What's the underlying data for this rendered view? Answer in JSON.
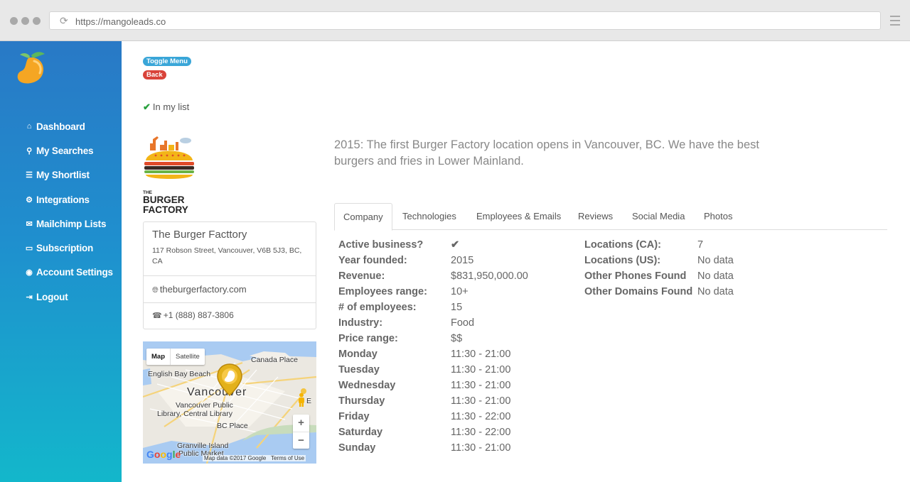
{
  "browser": {
    "url": "https://mangoleads.co"
  },
  "sidebar": {
    "items": [
      {
        "label": "Dashboard",
        "icon": "home-icon",
        "glyph": "⌂"
      },
      {
        "label": "My Searches",
        "icon": "search-icon",
        "glyph": "⚲"
      },
      {
        "label": "My Shortlist",
        "icon": "list-icon",
        "glyph": "☰"
      },
      {
        "label": "Integrations",
        "icon": "gears-icon",
        "glyph": "⚙"
      },
      {
        "label": "Mailchimp Lists",
        "icon": "envelope-icon",
        "glyph": "✉"
      },
      {
        "label": "Subscription",
        "icon": "credit-card-icon",
        "glyph": "▭"
      },
      {
        "label": "Account Settings",
        "icon": "user-circle-icon",
        "glyph": "◉"
      },
      {
        "label": "Logout",
        "icon": "sign-out-icon",
        "glyph": "⇥"
      }
    ]
  },
  "actions": {
    "toggle_menu": "Toggle Menu",
    "back": "Back"
  },
  "list_status": "In my list",
  "company": {
    "logo_text_line1": "THE",
    "logo_text_line2": "BURGER",
    "logo_text_line3": "FACTORY",
    "name": "The Burger Facttory",
    "address": "117 Robson Street, Vancouver, V6B 5J3, BC, CA",
    "website": "theburgerfactory.com",
    "phone": "+1 (888) 887-3806",
    "description": "2015: The first Burger Factory location opens in Vancouver, BC. We have the best burgers and fries in Lower Mainland."
  },
  "map": {
    "type_options": [
      "Map",
      "Satellite"
    ],
    "selected_type": "Map",
    "zoom_in": "+",
    "zoom_out": "−",
    "labels": {
      "canada_place": "Canada Place",
      "english_bay": "English Bay Beach",
      "vancouver": "Vancouver",
      "library_1": "Vancouver Public",
      "library_2": "Library, Central Library",
      "bc_place": "BC Place",
      "granville_1": "Granville Island",
      "granville_2": "Public Market",
      "partial_label": "E"
    },
    "attribution": "Map data ©2017 Google",
    "terms": "Terms of Use",
    "provider": "Google"
  },
  "tabs": [
    {
      "label": "Company",
      "active": true
    },
    {
      "label": "Technologies",
      "active": false
    },
    {
      "label": "Employees & Emails",
      "active": false
    },
    {
      "label": "Reviews",
      "active": false
    },
    {
      "label": "Social Media",
      "active": false
    },
    {
      "label": "Photos",
      "active": false
    }
  ],
  "details_left": [
    {
      "key": "Active business?",
      "value": "✔"
    },
    {
      "key": "Year founded:",
      "value": "2015"
    },
    {
      "key": "Revenue:",
      "value": "$831,950,000.00"
    },
    {
      "key": "Employees range:",
      "value": "10+"
    },
    {
      "key": "# of employees:",
      "value": "15"
    },
    {
      "key": "Industry:",
      "value": "Food"
    },
    {
      "key": "Price range:",
      "value": "$$"
    },
    {
      "key": "Monday",
      "value": "11:30 - 21:00"
    },
    {
      "key": "Tuesday",
      "value": "11:30 - 21:00"
    },
    {
      "key": "Wednesday",
      "value": "11:30 - 21:00"
    },
    {
      "key": "Thursday",
      "value": "11:30 - 21:00"
    },
    {
      "key": "Friday",
      "value": "11:30 - 22:00"
    },
    {
      "key": "Saturday",
      "value": "11:30 - 22:00"
    },
    {
      "key": "Sunday",
      "value": "11:30 - 21:00"
    }
  ],
  "details_right": [
    {
      "key": "Locations (CA):",
      "value": "7"
    },
    {
      "key": "Locations (US):",
      "value": "No data"
    },
    {
      "key": "Other Phones Found",
      "value": "No data"
    },
    {
      "key": "Other Domains Found",
      "value": "No data"
    }
  ],
  "colors": {
    "sidebar_top": "#2979c6",
    "sidebar_bottom": "#13b7cb",
    "toggle_pill": "#3aa6d8",
    "back_pill": "#d9433a",
    "check_green": "#27a03c",
    "mango": "#f5a623"
  }
}
